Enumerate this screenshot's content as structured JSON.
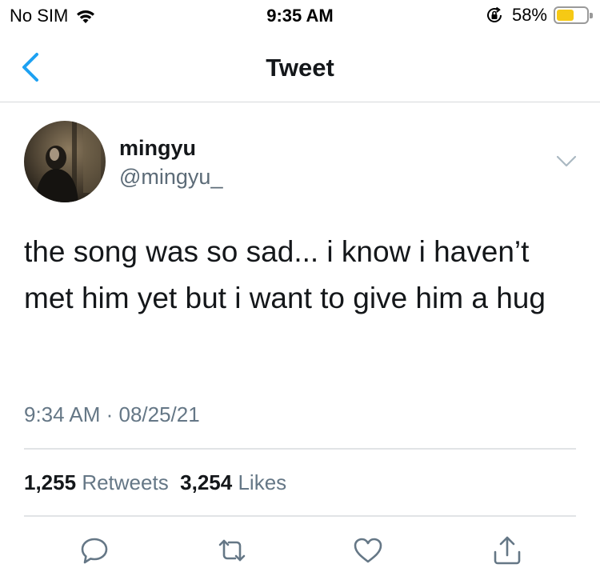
{
  "status_bar": {
    "carrier": "No SIM",
    "time": "9:35 AM",
    "battery_percent": "58%",
    "battery_level": 0.58,
    "icons": [
      "wifi-icon",
      "rotation-lock-icon",
      "battery-icon"
    ]
  },
  "nav": {
    "title": "Tweet",
    "back_icon": "chevron-left-icon"
  },
  "tweet": {
    "author": {
      "name": "mingyu",
      "handle": "@mingyu_"
    },
    "text": "the song was so sad... i know i haven’t met him yet but i want to give him a hug",
    "timestamp": "9:34 AM · 08/25/21",
    "stats": {
      "retweets_count": "1,255",
      "retweets_label": "Retweets",
      "likes_count": "3,254",
      "likes_label": "Likes"
    },
    "actions": [
      "reply-icon",
      "retweet-icon",
      "like-icon",
      "share-icon"
    ]
  },
  "colors": {
    "accent": "#1da1f2",
    "text_primary": "#14171a",
    "text_secondary": "#657786",
    "divider": "#e1e4e6",
    "battery": "#f6c915"
  }
}
